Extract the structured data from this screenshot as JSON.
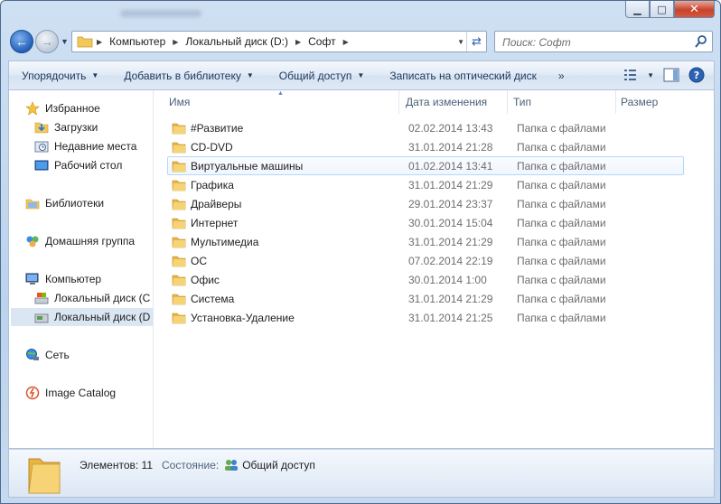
{
  "window": {
    "controls": [
      "minimize",
      "maximize",
      "close"
    ]
  },
  "address": {
    "crumbs": [
      "Компьютер",
      "Локальный диск (D:)",
      "Софт"
    ],
    "search_placeholder": "Поиск: Софт"
  },
  "commands": {
    "organize": "Упорядочить",
    "add_library": "Добавить в библиотеку",
    "share": "Общий доступ",
    "burn": "Записать на оптический диск",
    "more": "»"
  },
  "nav": {
    "favorites": "Избранное",
    "downloads": "Загрузки",
    "recent": "Недавние места",
    "desktop": "Рабочий стол",
    "libraries": "Библиотеки",
    "homegroup": "Домашняя группа",
    "computer": "Компьютер",
    "disk_c": "Локальный диск (C",
    "disk_d": "Локальный диск (D",
    "network": "Сеть",
    "image_catalog": "Image Catalog"
  },
  "columns": {
    "name": "Имя",
    "date": "Дата изменения",
    "type": "Тип",
    "size": "Размер"
  },
  "files": [
    {
      "name": "#Развитие",
      "date": "02.02.2014 13:43",
      "type": "Папка с файлами"
    },
    {
      "name": "CD-DVD",
      "date": "31.01.2014 21:28",
      "type": "Папка с файлами"
    },
    {
      "name": "Виртуальные машины",
      "date": "01.02.2014 13:41",
      "type": "Папка с файлами"
    },
    {
      "name": "Графика",
      "date": "31.01.2014 21:29",
      "type": "Папка с файлами"
    },
    {
      "name": "Драйверы",
      "date": "29.01.2014 23:37",
      "type": "Папка с файлами"
    },
    {
      "name": "Интернет",
      "date": "30.01.2014 15:04",
      "type": "Папка с файлами"
    },
    {
      "name": "Мультимедиа",
      "date": "31.01.2014 21:29",
      "type": "Папка с файлами"
    },
    {
      "name": "ОС",
      "date": "07.02.2014 22:19",
      "type": "Папка с файлами"
    },
    {
      "name": "Офис",
      "date": "30.01.2014 1:00",
      "type": "Папка с файлами"
    },
    {
      "name": "Система",
      "date": "31.01.2014 21:29",
      "type": "Папка с файлами"
    },
    {
      "name": "Установка-Удаление",
      "date": "31.01.2014 21:25",
      "type": "Папка с файлами"
    }
  ],
  "details": {
    "items_label": "Элементов: 11",
    "state_label": "Состояние:",
    "state_value": "Общий доступ"
  },
  "colors": {
    "accent": "#2460b8",
    "folder": "#f3c85a",
    "selection": "#dbe6f3",
    "hover_border": "#b8d6fb"
  }
}
